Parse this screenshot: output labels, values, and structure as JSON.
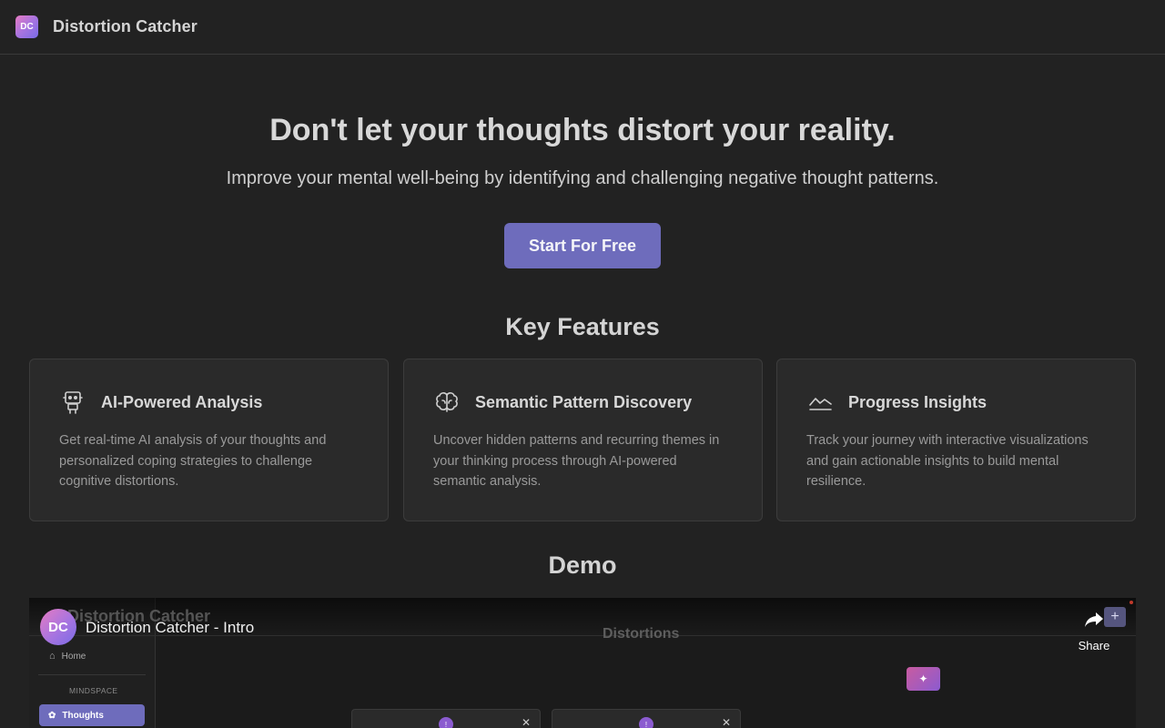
{
  "header": {
    "logo_text": "DC",
    "brand": "Distortion Catcher"
  },
  "hero": {
    "title": "Don't let your thoughts distort your reality.",
    "subtitle": "Improve your mental well-being by identifying and challenging negative thought patterns.",
    "cta_label": "Start For Free"
  },
  "features": {
    "title": "Key Features",
    "items": [
      {
        "icon": "robot-icon",
        "title": "AI-Powered Analysis",
        "description": "Get real-time AI analysis of your thoughts and personalized coping strategies to challenge cognitive distortions."
      },
      {
        "icon": "brain-icon",
        "title": "Semantic Pattern Discovery",
        "description": "Uncover hidden patterns and recurring themes in your thinking process through AI-powered semantic analysis."
      },
      {
        "icon": "trend-chart-icon",
        "title": "Progress Insights",
        "description": "Track your journey with interactive visualizations and gain actionable insights to build mental resilience."
      }
    ]
  },
  "demo": {
    "title": "Demo",
    "video": {
      "channel_avatar": "DC",
      "title": "Distortion Catcher - Intro",
      "share_label": "Share",
      "app_brand": "Distortion Catcher",
      "app_heading": "Distortions",
      "sidebar_home": "Home",
      "sidebar_section": "MINDSPACE",
      "sidebar_thoughts": "Thoughts"
    }
  },
  "colors": {
    "background": "#222222",
    "card": "#2a2a2a",
    "accent": "#6e6cbc"
  }
}
